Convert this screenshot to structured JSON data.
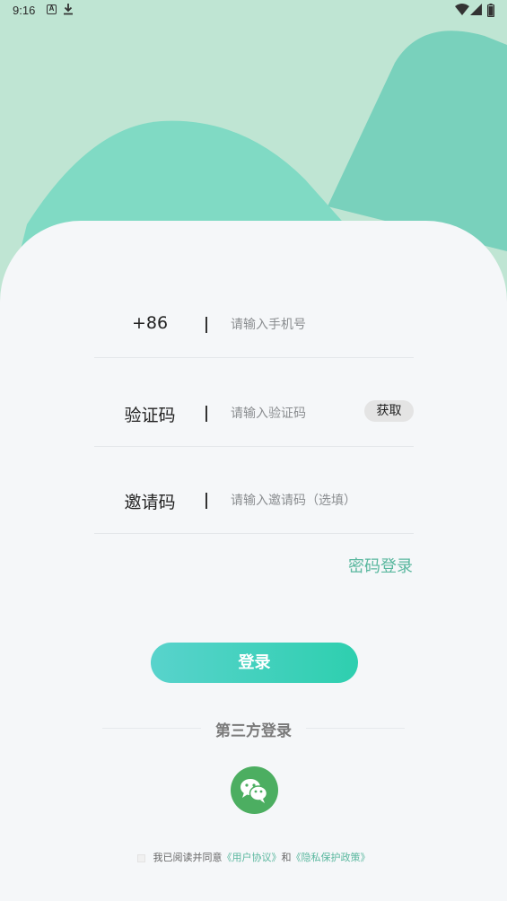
{
  "status_bar": {
    "time": "9:16",
    "left_icons": [
      "a-icon",
      "download-icon"
    ],
    "right_icons": [
      "wifi-icon",
      "signal-icon",
      "battery-icon"
    ]
  },
  "form": {
    "phone": {
      "label": "+86",
      "placeholder": "请输入手机号"
    },
    "code": {
      "label": "验证码",
      "placeholder": "请输入验证码",
      "button": "获取"
    },
    "invite": {
      "label": "邀请码",
      "placeholder": "请输入邀请码（选填）"
    }
  },
  "password_login": "密码登录",
  "login_button": "登录",
  "third_party": {
    "title": "第三方登录",
    "icon": "wechat-icon"
  },
  "agreement": {
    "prefix": "我已阅读并同意",
    "user_agreement": "《用户协议》",
    "and": "和",
    "privacy_policy": "《隐私保护政策》"
  },
  "colors": {
    "background_top": "#bfe5d3",
    "accent": "#59b79e",
    "login_gradient_start": "#58d3cc",
    "login_gradient_end": "#2ecfaf",
    "wechat": "#4cae61",
    "card": "#f5f7f9"
  }
}
